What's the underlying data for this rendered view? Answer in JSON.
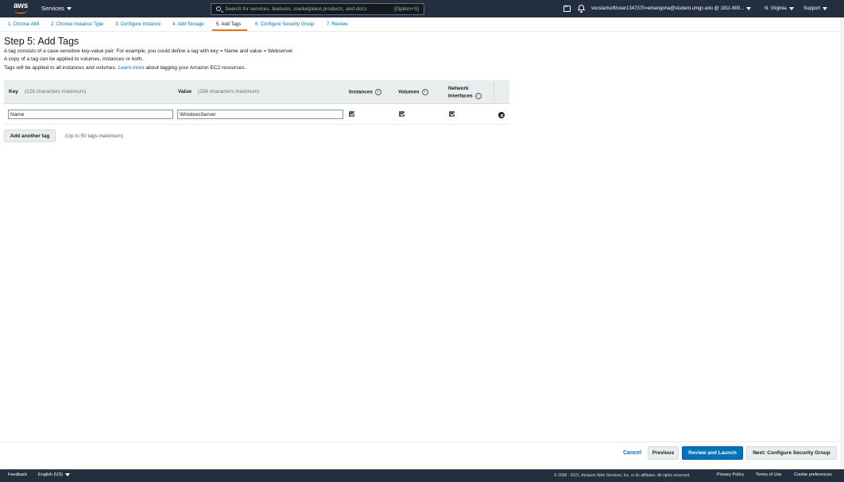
{
  "topnav": {
    "logo_text": "aws",
    "services_label": "Services",
    "search_placeholder": "Search for services, features, marketplace products, and docs",
    "search_shortcut": "[Option+S]",
    "account": "vocstartsoft/user1347370=emangona@student.umgc.edu @ 1911-600...",
    "region": "N. Virginia",
    "support": "Support",
    "icons": [
      "cloudshell-icon",
      "bell-icon"
    ]
  },
  "wizard": {
    "tabs": [
      {
        "label": "1. Choose AMI"
      },
      {
        "label": "2. Choose Instance Type"
      },
      {
        "label": "3. Configure Instance"
      },
      {
        "label": "4. Add Storage"
      },
      {
        "label": "5. Add Tags",
        "active": true
      },
      {
        "label": "6. Configure Security Group"
      },
      {
        "label": "7. Review"
      }
    ]
  },
  "main": {
    "title": "Step 5: Add Tags",
    "desc1": "A tag consists of a case-sensitive key-value pair. For example, you could define a tag with key = Name and value = Webserver.",
    "desc2": "A copy of a tag can be applied to volumes, instances or both.",
    "desc3_pre": "Tags will be applied to all instances and volumes.",
    "desc3_link": "Learn more",
    "desc3_post": "about tagging your Amazon EC2 resources."
  },
  "table": {
    "headers": {
      "key": "Key",
      "key_hint": "(128 characters maximum)",
      "value": "Value",
      "value_hint": "(256 characters maximum)",
      "instances": "Instances",
      "volumes": "Volumes",
      "network_line1": "Network",
      "network_line2": "Interfaces",
      "info_glyph": "i"
    },
    "rows": [
      {
        "key": "Name",
        "value": "WindowsServer",
        "instances": true,
        "volumes": true,
        "network_interfaces": true
      }
    ],
    "add_label": "Add another tag",
    "limit_text": "(Up to 50 tags maximum)"
  },
  "actions": {
    "cancel": "Cancel",
    "previous": "Previous",
    "review_launch": "Review and Launch",
    "next": "Next: Configure Security Group"
  },
  "footer": {
    "feedback": "Feedback",
    "language": "English (US)",
    "copyright": "© 2008 - 2021, Amazon Web Services, Inc. or its affiliates. All rights reserved.",
    "privacy": "Privacy Policy",
    "terms": "Terms of Use",
    "cookies": "Cookie preferences"
  },
  "colors": {
    "nav_bg": "#232f3e",
    "link": "#0073bb",
    "accent": "#ec7211",
    "primary_button": "#0073bb"
  }
}
